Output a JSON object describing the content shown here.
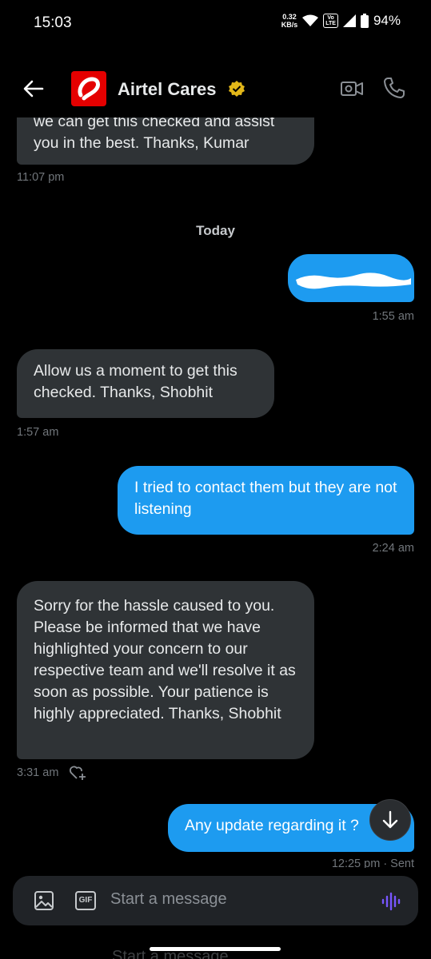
{
  "status_bar": {
    "time": "15:03",
    "speed_value": "0.32",
    "speed_unit": "KB/s",
    "volte_top": "Vo",
    "volte_bottom": "LTE",
    "battery": "94%"
  },
  "header": {
    "name": "Airtel Cares",
    "icons": [
      "back-arrow-icon",
      "airtel-logo",
      "verified-badge-icon",
      "video-call-icon",
      "phone-call-icon"
    ]
  },
  "messages": {
    "m0_text": "we can get this checked and assist you in the best. Thanks, Kumar",
    "m0_time": "11:07 pm",
    "day_divider": "Today",
    "m1_time": "1:55 am",
    "m2_text": "Allow us a moment to get this checked. Thanks, Shobhit",
    "m2_time": "1:57 am",
    "m3_text": "I tried to contact them but they are not listening",
    "m3_time": "2:24 am",
    "m4_text": "Sorry for the hassle caused to you. Please be informed that we have highlighted your concern to our respective team and we'll resolve it as soon as possible. Your patience is highly appreciated. Thanks, Shobhit",
    "m4_time": "3:31 am",
    "m5_text": "Any update regarding it ?",
    "m5_time": "12:25 pm · Sent"
  },
  "composer": {
    "placeholder": "Start a message",
    "gif_label": "GIF"
  },
  "colors": {
    "background": "#000000",
    "incoming_bubble": "#2f3336",
    "outgoing_bubble": "#1d9bf0",
    "verified": "#e2b719",
    "airtel_red": "#e40000",
    "voice_accent": "#7856ff"
  }
}
